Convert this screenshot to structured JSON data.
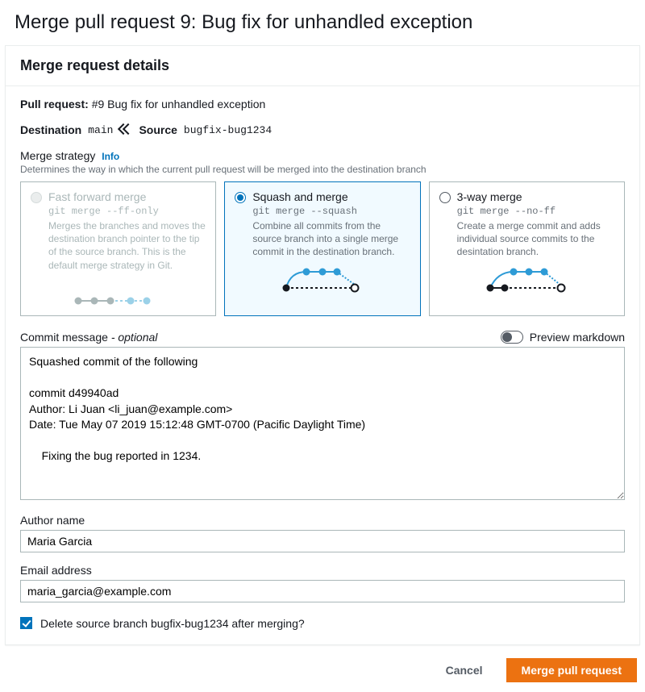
{
  "header": {
    "title": "Merge pull request 9: Bug fix for unhandled exception"
  },
  "panel": {
    "title": "Merge request details",
    "pull_request_label": "Pull request:",
    "pull_request_text": "#9 Bug fix for unhandled exception",
    "destination_label": "Destination",
    "destination_branch": "main",
    "source_label": "Source",
    "source_branch": "bugfix-bug1234"
  },
  "strategy": {
    "label": "Merge strategy",
    "info": "Info",
    "help": "Determines the way in which the current pull request will be merged into the destination branch",
    "options": [
      {
        "title": "Fast forward merge",
        "cmd": "git merge --ff-only",
        "desc": "Merges the branches and moves the destination branch pointer to the tip of the source branch. This is the default merge strategy in Git."
      },
      {
        "title": "Squash and merge",
        "cmd": "git merge --squash",
        "desc": "Combine all commits from the source branch into a single merge commit in the destination branch."
      },
      {
        "title": "3-way merge",
        "cmd": "git merge --no-ff",
        "desc": "Create a merge commit and adds individual source commits to the desintation branch."
      }
    ]
  },
  "commit": {
    "label": "Commit message",
    "optional": "- optional",
    "preview_label": "Preview markdown",
    "message": "Squashed commit of the following\n\ncommit d49940ad\nAuthor: Li Juan <li_juan@example.com>\nDate: Tue May 07 2019 15:12:48 GMT-0700 (Pacific Daylight Time)\n\n    Fixing the bug reported in 1234."
  },
  "author": {
    "name_label": "Author name",
    "name_value": "Maria Garcia",
    "email_label": "Email address",
    "email_value": "maria_garcia@example.com"
  },
  "delete_branch": {
    "label": "Delete source branch bugfix-bug1234 after merging?"
  },
  "footer": {
    "cancel": "Cancel",
    "merge": "Merge pull request"
  }
}
